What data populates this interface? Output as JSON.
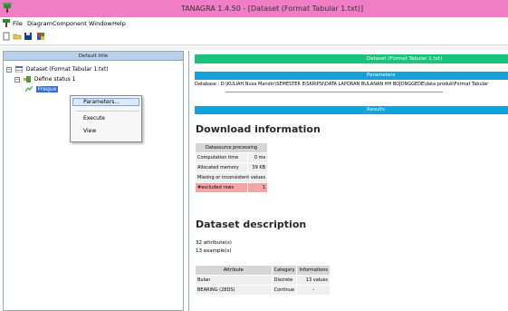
{
  "window": {
    "title": "TANAGRA 1.4.50 - [Dataset (Format Tabular 1.txt)]"
  },
  "menu": {
    "items": [
      "File",
      "Diagram",
      "Component",
      "Window",
      "Help"
    ]
  },
  "toolbar": {
    "buttons": [
      "new-diagram-icon",
      "open-icon",
      "save-icon",
      "load-data-icon"
    ]
  },
  "left": {
    "header": "Default title",
    "tree": {
      "root": "Dataset (Format Tabular 1.txt)",
      "child": "Define status 1",
      "grandchild": "Freque"
    }
  },
  "context_menu": {
    "items": [
      "Parameters...",
      "Execute",
      "View"
    ]
  },
  "right": {
    "header": "Dataset (Format Tabular 1.txt)",
    "parameters_label": "Parameters",
    "database_line": "Database : D:\\KULIAH Nusa Mandiri\\SEMESTER 8\\SKRIPSI\\DATA LAPORAN BULANAN HH BOJONGGEDE\\data produk\\Format Tabular",
    "results_label": "Results",
    "download_title": "Download information",
    "download_table": {
      "header": "Datasource processing",
      "rows": [
        {
          "label": "Computation time",
          "value": "0 ms"
        },
        {
          "label": "Allocated memory",
          "value": "39 KB"
        },
        {
          "label": "Missing or inconsistent values",
          "value": ""
        },
        {
          "label": "#excluded rows",
          "value": "1"
        }
      ]
    },
    "dataset_title": "Dataset description",
    "attributes_count": "32 attribute(s)",
    "examples_count": "13 example(s)",
    "attr_table": {
      "columns": [
        "Attribute",
        "Category",
        "Informations"
      ],
      "rows": [
        [
          "Bulan",
          "Discrete",
          "13 values"
        ],
        [
          "BEARING (28DS)",
          "Continue",
          "-"
        ]
      ]
    }
  }
}
